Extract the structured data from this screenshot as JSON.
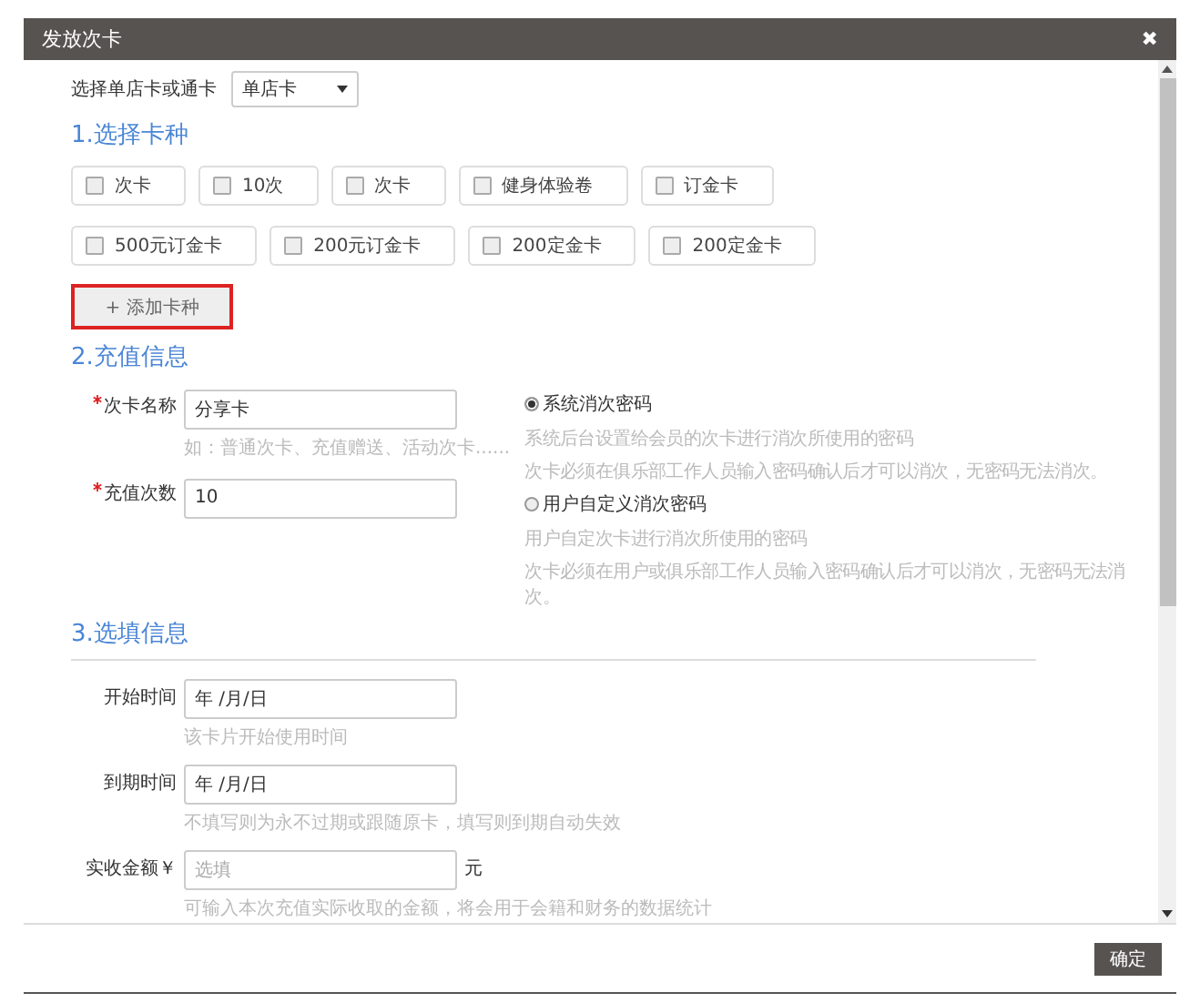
{
  "window": {
    "title": "发放次卡",
    "close": "✖"
  },
  "store_select": {
    "label": "选择单店卡或通卡",
    "value": "单店卡"
  },
  "section_1": {
    "title": "1.选择卡种",
    "card_types": [
      {
        "label": "次卡",
        "checked": false
      },
      {
        "label": "10次",
        "checked": false
      },
      {
        "label": "次卡",
        "checked": false
      },
      {
        "label": "健身体验卷",
        "checked": false
      },
      {
        "label": "订金卡",
        "checked": false
      },
      {
        "label": "500元订金卡",
        "checked": false
      },
      {
        "label": "200元订金卡",
        "checked": false
      },
      {
        "label": "200定金卡",
        "checked": false
      },
      {
        "label": "200定金卡",
        "checked": false
      }
    ],
    "add_button": "+ 添加卡种"
  },
  "section_2": {
    "title": "2.充值信息",
    "fields": [
      {
        "label": "次卡名称",
        "required": true,
        "value": "分享卡",
        "hint": "如：普通次卡、充值赠送、活动次卡......"
      },
      {
        "label": "充值次数",
        "required": true,
        "value": "10"
      }
    ],
    "password_options": [
      {
        "label": "系统消次密码",
        "selected": true,
        "hints": [
          "系统后台设置给会员的次卡进行消次所使用的密码",
          "次卡必须在俱乐部工作人员输入密码确认后才可以消次，无密码无法消次。"
        ]
      },
      {
        "label": "用户自定义消次密码",
        "selected": false,
        "hints": [
          "用户自定次卡进行消次所使用的密码",
          "次卡必须在用户或俱乐部工作人员输入密码确认后才可以消次，无密码无法消次。"
        ]
      }
    ]
  },
  "section_3": {
    "title": "3.选填信息",
    "fields": [
      {
        "kind": "date",
        "label": "开始时间",
        "value": "年 /月/日",
        "hint": "该卡片开始使用时间"
      },
      {
        "kind": "date",
        "label": "到期时间",
        "value": "年 /月/日",
        "hint": "不填写则为永不过期或跟随原卡，填写则到期自动失效"
      },
      {
        "kind": "money",
        "label": "实收金额￥",
        "placeholder": "选填",
        "unit": "元",
        "hint": "可输入本次充值实际收取的金额，将会用于会籍和财务的数据统计"
      }
    ]
  },
  "footer": {
    "confirm": "确定"
  }
}
